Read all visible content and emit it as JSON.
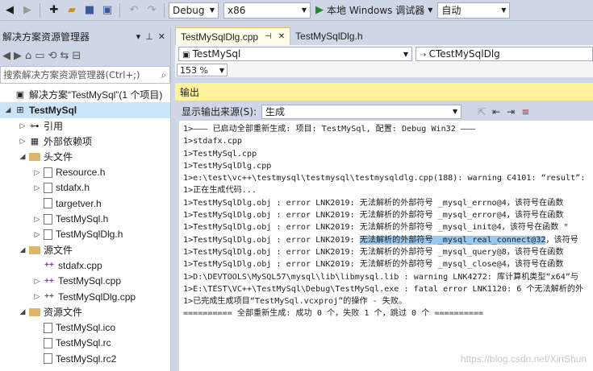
{
  "toolbar": {
    "config": "Debug",
    "platform": "x86",
    "run_label": "本地 Windows 调试器",
    "auto_label": "自动"
  },
  "solution_explorer": {
    "title": "解决方案资源管理器",
    "search_placeholder": "搜索解决方案资源管理器(Ctrl+;)",
    "tree": [
      {
        "label": "解决方案“TestMySql”(1 个项目)",
        "indent": 0,
        "icon": "solution-icon",
        "expander": ""
      },
      {
        "label": "TestMySql",
        "indent": 0,
        "icon": "project-icon",
        "expander": "◢",
        "bold": true,
        "selected": true
      },
      {
        "label": "引用",
        "indent": 1,
        "icon": "references-icon",
        "expander": "▷"
      },
      {
        "label": "外部依赖项",
        "indent": 1,
        "icon": "external-deps-icon",
        "expander": "▷"
      },
      {
        "label": "头文件",
        "indent": 1,
        "icon": "folder-icon",
        "expander": "◢"
      },
      {
        "label": "Resource.h",
        "indent": 2,
        "icon": "header-file-icon",
        "expander": "▷"
      },
      {
        "label": "stdafx.h",
        "indent": 2,
        "icon": "header-file-icon",
        "expander": "▷"
      },
      {
        "label": "targetver.h",
        "indent": 2,
        "icon": "header-file-icon",
        "expander": ""
      },
      {
        "label": "TestMySql.h",
        "indent": 2,
        "icon": "header-file-icon",
        "expander": "▷"
      },
      {
        "label": "TestMySqlDlg.h",
        "indent": 2,
        "icon": "header-file-icon",
        "expander": "▷"
      },
      {
        "label": "源文件",
        "indent": 1,
        "icon": "folder-icon",
        "expander": "◢"
      },
      {
        "label": "stdafx.cpp",
        "indent": 2,
        "icon": "cpp-file-icon",
        "expander": ""
      },
      {
        "label": "TestMySql.cpp",
        "indent": 2,
        "icon": "cpp-file-icon",
        "expander": "▷"
      },
      {
        "label": "TestMySqlDlg.cpp",
        "indent": 2,
        "icon": "cpp-file-icon",
        "expander": "▷"
      },
      {
        "label": "资源文件",
        "indent": 1,
        "icon": "folder-icon",
        "expander": "◢"
      },
      {
        "label": "TestMySql.ico",
        "indent": 2,
        "icon": "image-file-icon",
        "expander": ""
      },
      {
        "label": "TestMySql.rc",
        "indent": 2,
        "icon": "resource-file-icon",
        "expander": ""
      },
      {
        "label": "TestMySql.rc2",
        "indent": 2,
        "icon": "resource-file-icon",
        "expander": ""
      }
    ]
  },
  "editor": {
    "tabs": [
      {
        "label": "TestMySqlDlg.cpp",
        "active": true,
        "pin": "⊣",
        "close": "✕"
      },
      {
        "label": "TestMySqlDlg.h",
        "active": false
      }
    ],
    "nav_left": "TestMySql",
    "nav_right": "CTestMySqlDlg",
    "zoom": "153 %"
  },
  "output": {
    "title": "输出",
    "source_label": "显示输出来源(S):",
    "source_value": "生成",
    "lines": [
      "1>——— 已启动全部重新生成: 项目: TestMySql, 配置: Debug Win32 ———",
      "1>stdafx.cpp",
      "1>TestMySql.cpp",
      "1>TestMySqlDlg.cpp",
      "1>e:\\test\\vc++\\testmysql\\testmysql\\testmysqldlg.cpp(188): warning C4101: “result”: ",
      "1>正在生成代码...",
      "1>TestMySqlDlg.obj : error LNK2019: 无法解析的外部符号 _mysql_errno@4，该符号在函数",
      "1>TestMySqlDlg.obj : error LNK2019: 无法解析的外部符号 _mysql_error@4，该符号在函数",
      "1>TestMySqlDlg.obj : error LNK2019: 无法解析的外部符号 _mysql_init@4，该符号在函数 \"",
      "1>TestMySqlDlg.obj : error LNK2019: 无法解析的外部符号 _mysql_real_connect@32，该符号",
      "1>TestMySqlDlg.obj : error LNK2019: 无法解析的外部符号 _mysql_query@8，该符号在函数",
      "1>TestMySqlDlg.obj : error LNK2019: 无法解析的外部符号 _mysql_close@4，该符号在函数",
      "1>D:\\DEVTOOLS\\MySQL57\\mysql\\lib\\libmysql.lib : warning LNK4272: 库计算机类型“x64”与",
      "1>E:\\TEST\\VC++\\TestMySql\\Debug\\TestMySql.exe : fatal error LNK1120: 6 个无法解析的外",
      "1>已完成生成项目“TestMySql.vcxproj”的操作 - 失败。",
      "========== 全部重新生成: 成功 0 个，失败 1 个，跳过 0 个 =========="
    ]
  },
  "watermark": "https://blog.csdn.net/XinShun"
}
